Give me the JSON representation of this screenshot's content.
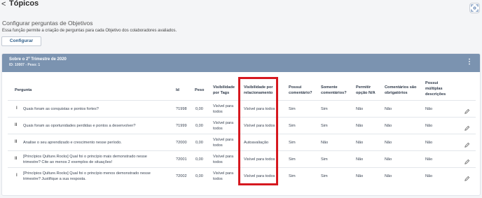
{
  "header": {
    "back_glyph": "<",
    "title": "Tópicos",
    "scan_icon": "scan-icon"
  },
  "section": {
    "subtitle": "Configurar perguntas de Objetivos",
    "description": "Essa função permite a criação de perguntas para cada Objetivo dos colaboradores avaliados.",
    "configure_label": "Configurar"
  },
  "card": {
    "title": "Sobre o 2º Trimestre de 2020",
    "subtitle": "ID: 10007 - Peso: 1",
    "menu_icon": "kebab-menu-icon"
  },
  "table": {
    "headers": {
      "pergunta": "Pergunta",
      "id": "Id",
      "peso": "Peso",
      "vis_tags": "Visibilidade por Tags",
      "vis_rel": "Visibilidade por relacionamento",
      "possui_com": "Possui comentário?",
      "somente_com": "Somente comentários?",
      "permitir_na": "Permitir opção N/A",
      "com_obrig": "Comentários são obrigatórios",
      "multiplas": "Possui múltiplas descrições"
    },
    "rows": [
      {
        "drag": "I",
        "pergunta_l1": "Quais foram as conquistas e pontos fortes?",
        "pergunta_l2": "",
        "id": "?1998",
        "peso": "0,00",
        "vis_tags_l1": "Visível para",
        "vis_tags_l2": "todos",
        "vis_rel": "Visível para todos",
        "possui_com": "Sim",
        "somente_com": "Sim",
        "permitir_na": "Não",
        "com_obrig": "Não",
        "multiplas": "Não"
      },
      {
        "drag": "II",
        "pergunta_l1": "Quais foram as oportunidades perdidas e pontos a desenvolver?",
        "pergunta_l2": "",
        "id": "?1999",
        "peso": "0,00",
        "vis_tags_l1": "Visível para",
        "vis_tags_l2": "todos",
        "vis_rel": "Visível para todos",
        "possui_com": "Sim",
        "somente_com": "Sim",
        "permitir_na": "Não",
        "com_obrig": "Não",
        "multiplas": "Não"
      },
      {
        "drag": "II",
        "pergunta_l1": "Analise o seu aprendizado e crescimento nesse período.",
        "pergunta_l2": "",
        "id": "?2000",
        "peso": "0,00",
        "vis_tags_l1": "Visível para",
        "vis_tags_l2": "todos",
        "vis_rel": "Autoavaliação",
        "possui_com": "Sim",
        "somente_com": "Não",
        "permitir_na": "Não",
        "com_obrig": "Não",
        "multiplas": "Não"
      },
      {
        "drag": "II",
        "pergunta_l1": "[Princípios Qulture.Rocks] Qual foi o princípio mais demonstrado nesse",
        "pergunta_l2": "trimestre? Cite ao menos 2 exemplos de situações!",
        "id": "?2001",
        "peso": "0,00",
        "vis_tags_l1": "Visível para",
        "vis_tags_l2": "todos",
        "vis_rel": "Visível para todos",
        "possui_com": "Sim",
        "somente_com": "Sim",
        "permitir_na": "Não",
        "com_obrig": "Não",
        "multiplas": "Não"
      },
      {
        "drag": "I",
        "pergunta_l1": "[Princípios Qulture.Rocks] Qual foi o princípio menos demonstrado nesse",
        "pergunta_l2": "trimestre? Justifique a sua resposta.",
        "id": "?2002",
        "peso": "0,00",
        "vis_tags_l1": "Visível para",
        "vis_tags_l2": "todos",
        "vis_rel": "Visível para todos",
        "possui_com": "Sim",
        "somente_com": "Sim",
        "permitir_na": "Não",
        "com_obrig": "Não",
        "multiplas": "Não"
      }
    ]
  },
  "colors": {
    "card_header": "#7b93b0",
    "highlight": "#d6181f"
  }
}
